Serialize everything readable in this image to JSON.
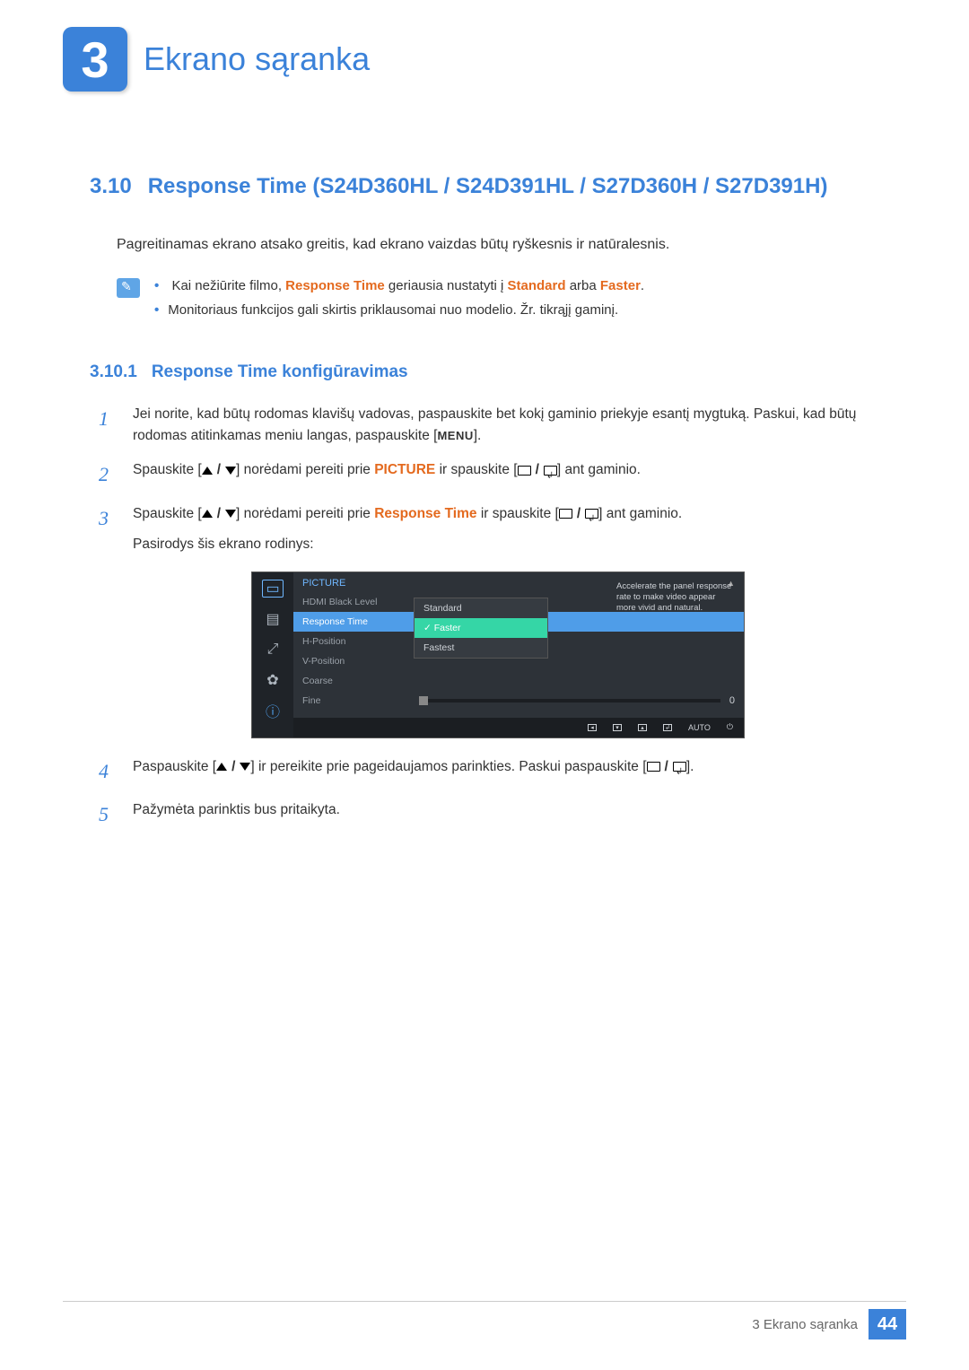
{
  "chapter": {
    "number": "3",
    "title": "Ekrano sąranka"
  },
  "section": {
    "number": "3.10",
    "title": "Response Time (S24D360HL / S24D391HL / S27D360H / S27D391H)"
  },
  "intro": "Pagreitinamas ekrano atsako greitis, kad ekrano vaizdas būtų ryškesnis ir natūralesnis.",
  "notes": {
    "items": [
      {
        "pre": "Kai nežiūrite filmo, ",
        "hl1": "Response Time",
        "mid": " geriausia nustatyti į ",
        "hl2": "Standard",
        "mid2": " arba ",
        "hl3": "Faster",
        "post": "."
      },
      {
        "plain": "Monitoriaus funkcijos gali skirtis priklausomai nuo modelio. Žr. tikrąjį gaminį."
      }
    ]
  },
  "subsection": {
    "number": "3.10.1",
    "title": "Response Time konfigūravimas"
  },
  "steps": [
    {
      "n": "1",
      "t1": "Jei norite, kad būtų rodomas klavišų vadovas, paspauskite bet kokį gaminio priekyje esantį mygtuką. Paskui, kad būtų rodomas atitinkamas meniu langas, paspauskite [",
      "menu": "MENU",
      "t2": "]."
    },
    {
      "n": "2",
      "t1": "Spauskite [",
      "arrows": true,
      "t2": "] norėdami pereiti prie ",
      "hl": "PICTURE",
      "t3": " ir spauskite [",
      "rects": true,
      "t4": "] ant gaminio."
    },
    {
      "n": "3",
      "t1": "Spauskite [",
      "arrows": true,
      "t2": "] norėdami pereiti prie ",
      "hl": "Response Time",
      "t3": " ir spauskite [",
      "rects": true,
      "t4": "] ant gaminio.",
      "extra": "Pasirodys šis ekrano rodinys:"
    },
    {
      "n": "4",
      "t1": "Paspauskite [",
      "arrows": true,
      "t2": "] ir pereikite prie pageidaujamos parinkties. Paskui paspauskite [",
      "rects": true,
      "t3": "]."
    },
    {
      "n": "5",
      "plain": "Pažymėta parinktis bus pritaikyta."
    }
  ],
  "osd": {
    "title": "PICTURE",
    "desc": "Accelerate the panel response rate to make video appear more vivid and natural.",
    "rows": [
      {
        "label": "HDMI Black Level"
      },
      {
        "label": "Response Time",
        "selected": true
      },
      {
        "label": "H-Position"
      },
      {
        "label": "V-Position"
      },
      {
        "label": "Coarse"
      },
      {
        "label": "Fine",
        "slider": true,
        "val": "0"
      }
    ],
    "submenu": [
      {
        "label": "Standard"
      },
      {
        "label": "Faster",
        "selected": true
      },
      {
        "label": "Fastest"
      }
    ],
    "bottom_auto": "AUTO"
  },
  "footer": {
    "label": "3 Ekrano sąranka",
    "page": "44"
  }
}
